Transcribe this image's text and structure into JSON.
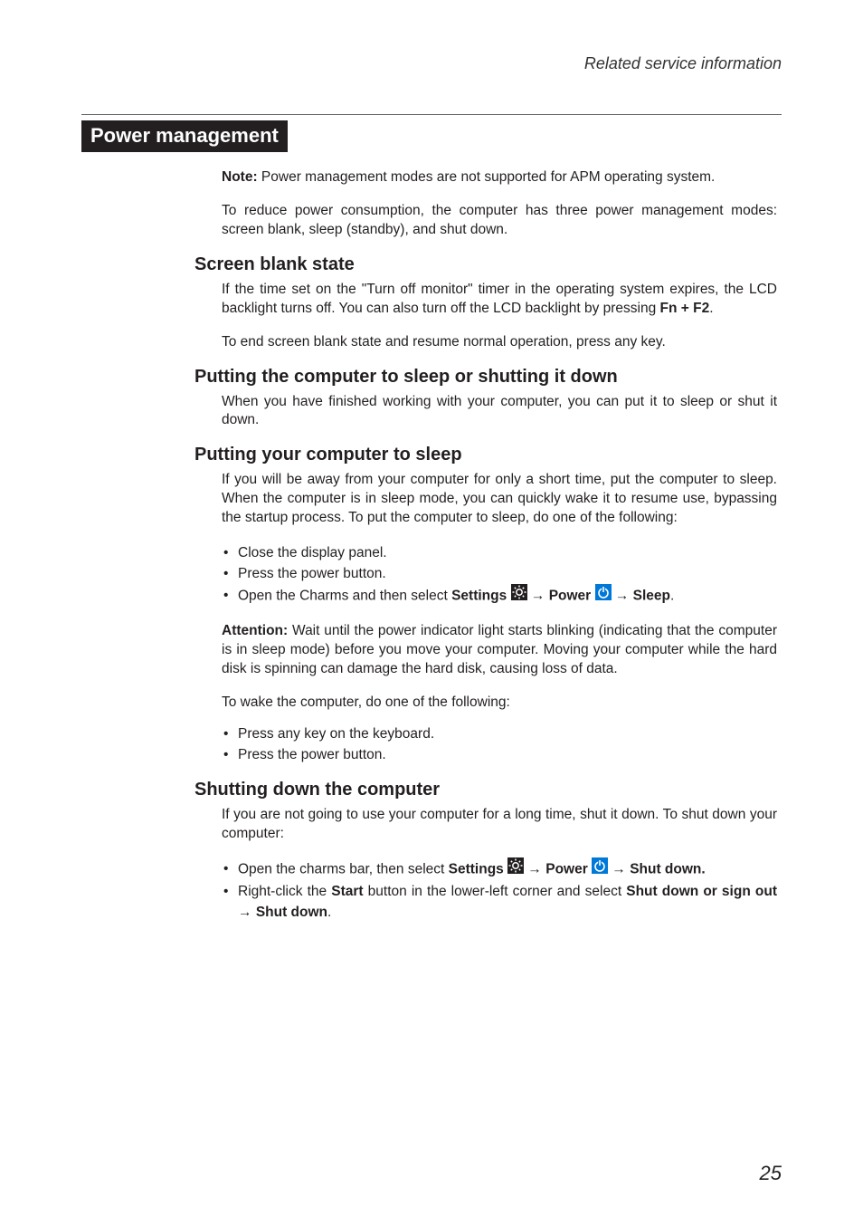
{
  "header": "Related service information",
  "banner": "Power management",
  "note": {
    "label": "Note:",
    "text": " Power management modes are not supported for APM operating system."
  },
  "intro": "To reduce power consumption, the computer has three power management modes: screen blank, sleep (standby), and shut down.",
  "s1": {
    "title": "Screen blank state",
    "p1a": "If the time set on the \"Turn off monitor\" timer in the operating system expires, the LCD backlight turns off. You can also turn off the LCD backlight by pressing ",
    "p1b": "Fn + F2",
    "p1c": ".",
    "p2": "To end screen blank state and resume normal operation, press any key."
  },
  "s2": {
    "title": "Putting the computer to sleep or shutting it down",
    "p1": "When you have finished working with your computer, you can put it to sleep or shut it down."
  },
  "s3": {
    "title": "Putting your computer to sleep",
    "p1": "If you will be away from your computer for only a short time, put the computer to sleep. When the computer is in sleep mode, you can quickly wake it to resume use, bypassing the startup process. To put the computer to sleep, do one of the following:",
    "li1": "Close the display panel.",
    "li2": "Press the power button.",
    "li3a": "Open the Charms and then select ",
    "li3b": "Settings",
    "li3c": " → ",
    "li3d": "Power",
    "li3e": " → ",
    "li3f": "Sleep",
    "li3g": ".",
    "att_label": "Attention:",
    "att_text": " Wait until the power indicator light starts blinking (indicating that the computer is in sleep mode) before you move your computer. Moving your computer while the hard disk is spinning can damage the hard disk, causing loss of data.",
    "p2": "To wake the computer, do one of the following:",
    "li4": "Press any key on the keyboard.",
    "li5": "Press the power button."
  },
  "s4": {
    "title": "Shutting down the computer",
    "p1": "If you are not going to use your computer for a long time, shut it down. To shut down your computer:",
    "li1a": "Open the charms bar, then select ",
    "li1b": "Settings",
    "li1c": " → ",
    "li1d": "Power",
    "li1e": " → ",
    "li1f": "Shut down.",
    "li2a": "Right-click the ",
    "li2b": "Start",
    "li2c": " button in the lower-left corner and select ",
    "li2d": "Shut down or sign out",
    "li2e": " → ",
    "li2f": "Shut down",
    "li2g": "."
  },
  "page": "25"
}
